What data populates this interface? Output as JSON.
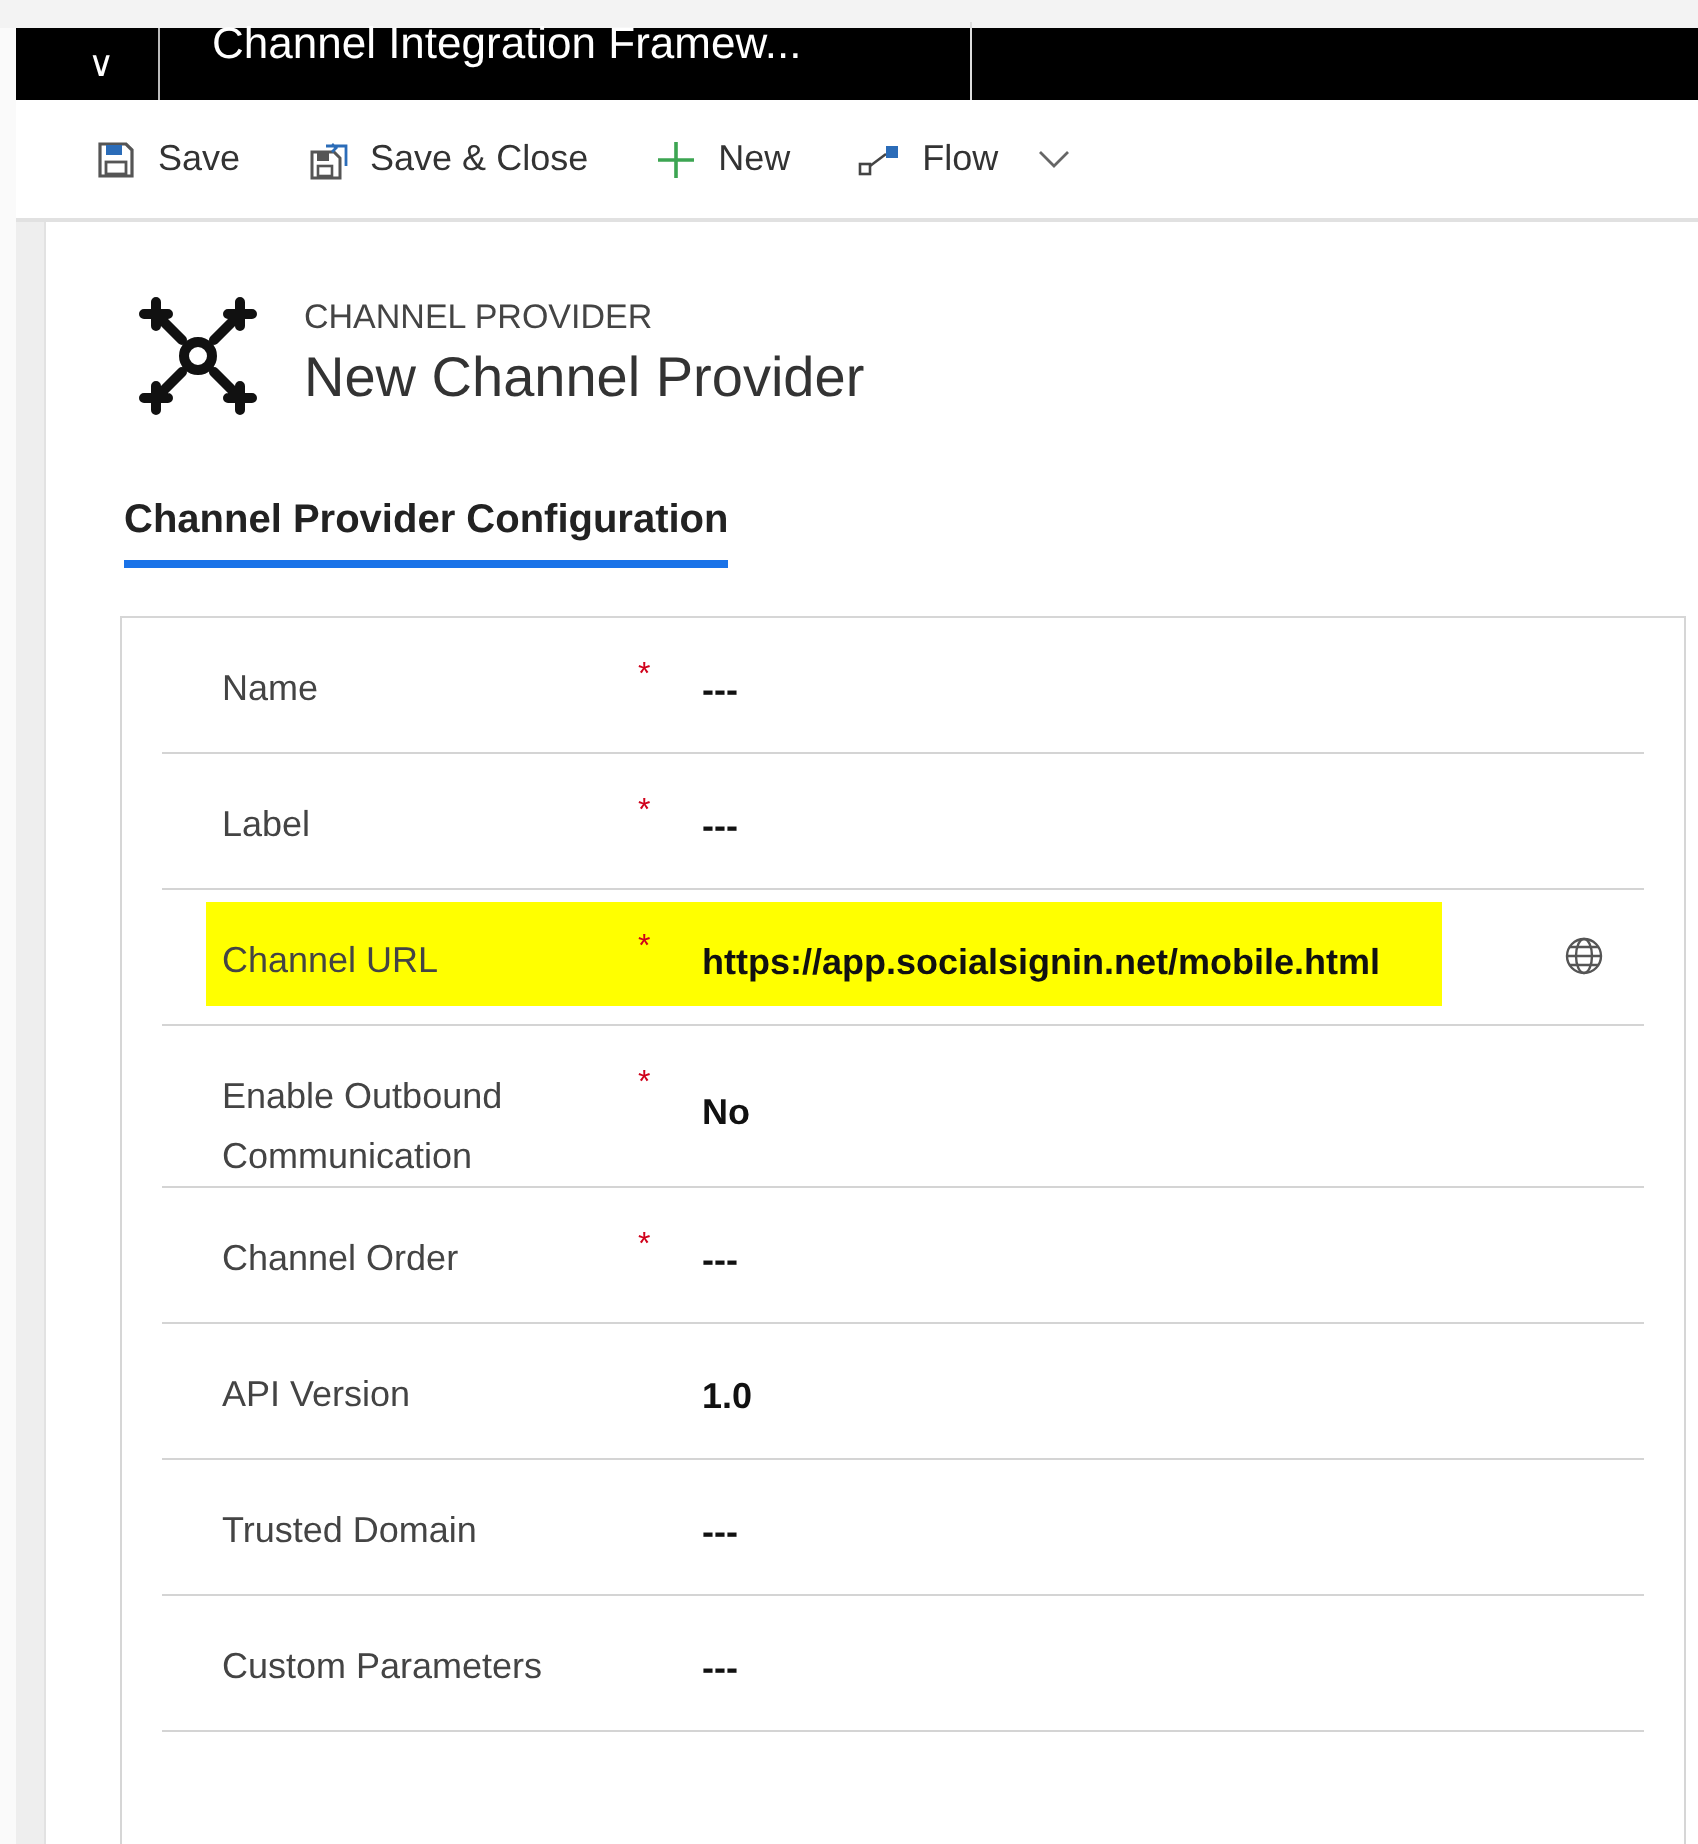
{
  "app_bar": {
    "menu_chevron": "∨",
    "tab_title": "Channel Integration Framew..."
  },
  "command_bar": [
    {
      "kind": "save",
      "label": "Save"
    },
    {
      "kind": "save_close",
      "label": "Save & Close"
    },
    {
      "kind": "new",
      "label": "New"
    },
    {
      "kind": "flow",
      "label": "Flow"
    }
  ],
  "header": {
    "entity": "CHANNEL PROVIDER",
    "title": "New Channel Provider"
  },
  "tabs": [
    {
      "label": "Channel Provider Configuration",
      "selected": true
    }
  ],
  "fields": [
    {
      "label": "Name",
      "required_mark": "*",
      "value": "---",
      "kind": "text",
      "highlighted": false
    },
    {
      "label": "Label",
      "required_mark": "*",
      "value": "---",
      "kind": "text",
      "highlighted": false
    },
    {
      "label": "Channel URL",
      "required_mark": "*",
      "value": "https://app.socialsignin.net/mobile.html",
      "kind": "url",
      "highlighted": true
    },
    {
      "label": "Enable Outbound Communication",
      "required_mark": "*",
      "value": "No",
      "kind": "text",
      "highlighted": false
    },
    {
      "label": "Channel Order",
      "required_mark": "*",
      "value": "---",
      "kind": "text",
      "highlighted": false
    },
    {
      "label": "API Version",
      "value": "1.0",
      "kind": "text",
      "highlighted": false
    },
    {
      "label": "Trusted Domain",
      "value": "---",
      "kind": "text",
      "highlighted": false
    },
    {
      "label": "Custom Parameters",
      "value": "---",
      "kind": "text",
      "highlighted": false
    }
  ]
}
